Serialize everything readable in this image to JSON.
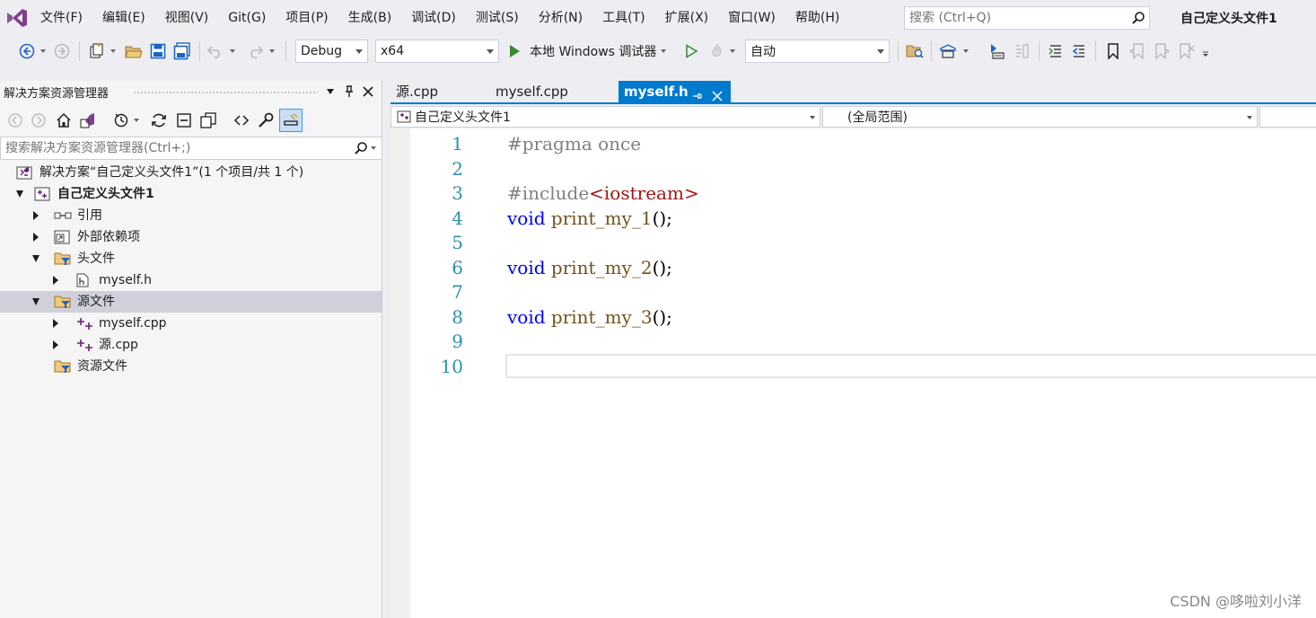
{
  "menu": {
    "items": [
      "文件(F)",
      "编辑(E)",
      "视图(V)",
      "Git(G)",
      "项目(P)",
      "生成(B)",
      "调试(D)",
      "测试(S)",
      "分析(N)",
      "工具(T)",
      "扩展(X)",
      "窗口(W)",
      "帮助(H)"
    ],
    "search_placeholder": "搜索 (Ctrl+Q)",
    "window_title": "自己定义头文件1"
  },
  "toolbar": {
    "config": "Debug",
    "platform": "x64",
    "run_label": "本地 Windows 调试器",
    "target": "自动"
  },
  "solution_explorer": {
    "title": "解决方案资源管理器",
    "search_placeholder": "搜索解决方案资源管理器(Ctrl+;)",
    "tree": [
      {
        "label": "解决方案“自己定义头文件1”(1 个项目/共 1 个)",
        "level": 0,
        "icon": "solution-icon",
        "expander": "none"
      },
      {
        "label": "自己定义头文件1",
        "level": 0,
        "icon": "project-icon",
        "expander": "expanded",
        "bold": true
      },
      {
        "label": "引用",
        "level": 1,
        "icon": "references-icon",
        "expander": "collapsed"
      },
      {
        "label": "外部依赖项",
        "level": 1,
        "icon": "external-deps-icon",
        "expander": "collapsed"
      },
      {
        "label": "头文件",
        "level": 1,
        "icon": "filter-folder-icon",
        "expander": "expanded"
      },
      {
        "label": "myself.h",
        "level": 2,
        "icon": "header-file-icon",
        "expander": "collapsed"
      },
      {
        "label": "源文件",
        "level": 1,
        "icon": "filter-folder-icon",
        "expander": "expanded",
        "selected": true
      },
      {
        "label": "myself.cpp",
        "level": 2,
        "icon": "cpp-file-icon",
        "expander": "collapsed"
      },
      {
        "label": "源.cpp",
        "level": 2,
        "icon": "cpp-file-icon",
        "expander": "collapsed"
      },
      {
        "label": "资源文件",
        "level": 1,
        "icon": "filter-folder-icon",
        "expander": "none"
      }
    ]
  },
  "editor": {
    "tabs": [
      {
        "label": "源.cpp",
        "active": false
      },
      {
        "label": "myself.cpp",
        "active": false
      },
      {
        "label": "myself.h",
        "active": true
      }
    ],
    "nav_project": "自己定义头文件1",
    "nav_scope": "(全局范围)",
    "lines": [
      {
        "num": "1",
        "tokens": [
          {
            "t": "#pragma once",
            "c": "pre"
          }
        ]
      },
      {
        "num": "2",
        "tokens": []
      },
      {
        "num": "3",
        "tokens": [
          {
            "t": "#include",
            "c": "pre"
          },
          {
            "t": "<iostream>",
            "c": "inc"
          }
        ]
      },
      {
        "num": "4",
        "tokens": [
          {
            "t": "void",
            "c": "kw"
          },
          {
            "t": " ",
            "c": "plain"
          },
          {
            "t": "print_my_1",
            "c": "fn"
          },
          {
            "t": "();",
            "c": "plain"
          }
        ]
      },
      {
        "num": "5",
        "tokens": []
      },
      {
        "num": "6",
        "tokens": [
          {
            "t": "void",
            "c": "kw"
          },
          {
            "t": " ",
            "c": "plain"
          },
          {
            "t": "print_my_2",
            "c": "fn"
          },
          {
            "t": "();",
            "c": "plain"
          }
        ]
      },
      {
        "num": "7",
        "tokens": []
      },
      {
        "num": "8",
        "tokens": [
          {
            "t": "void",
            "c": "kw"
          },
          {
            "t": " ",
            "c": "plain"
          },
          {
            "t": "print_my_3",
            "c": "fn"
          },
          {
            "t": "();",
            "c": "plain"
          }
        ]
      },
      {
        "num": "9",
        "tokens": []
      },
      {
        "num": "10",
        "tokens": [],
        "current": true
      }
    ]
  },
  "watermark": "CSDN @哆啦刘小洋",
  "colors": {
    "accent": "#007acc",
    "line_number": "#2b91af",
    "keyword": "#0000ff",
    "function": "#74531f",
    "include_path": "#a31515",
    "preprocessor": "#808080"
  }
}
